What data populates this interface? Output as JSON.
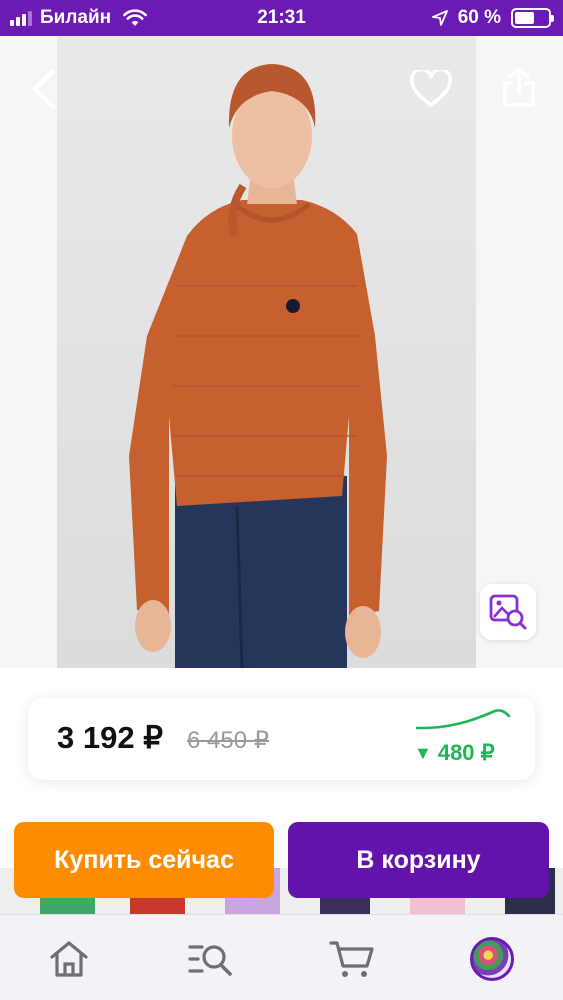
{
  "status_bar": {
    "carrier": "Билайн",
    "time": "21:31",
    "battery_percent": "60 %",
    "battery_level": 0.6,
    "signal_bars_active": 3
  },
  "product": {
    "image_icons": {
      "back": "back-chevron-icon",
      "favorite": "heart-icon",
      "share": "share-icon",
      "visual_search": "image-search-icon"
    }
  },
  "price_card": {
    "current_price": "3 192 ₽",
    "old_price": "6 450 ₽",
    "price_drop": "480 ₽",
    "drop_arrow": "▼",
    "trend_color": "#1fb455"
  },
  "actions": {
    "buy_now_label": "Купить сейчас",
    "add_to_cart_label": "В корзину"
  },
  "colors": {
    "brand": "#6b1bb3",
    "buy_now": "#fe8c00",
    "add_to_cart": "#6313ab",
    "sweater": "#c6602f"
  },
  "tab_bar": {
    "items": [
      {
        "name": "home",
        "icon": "home-icon"
      },
      {
        "name": "catalog",
        "icon": "catalog-search-icon"
      },
      {
        "name": "cart",
        "icon": "cart-icon"
      },
      {
        "name": "profile",
        "icon": "avatar"
      }
    ]
  }
}
